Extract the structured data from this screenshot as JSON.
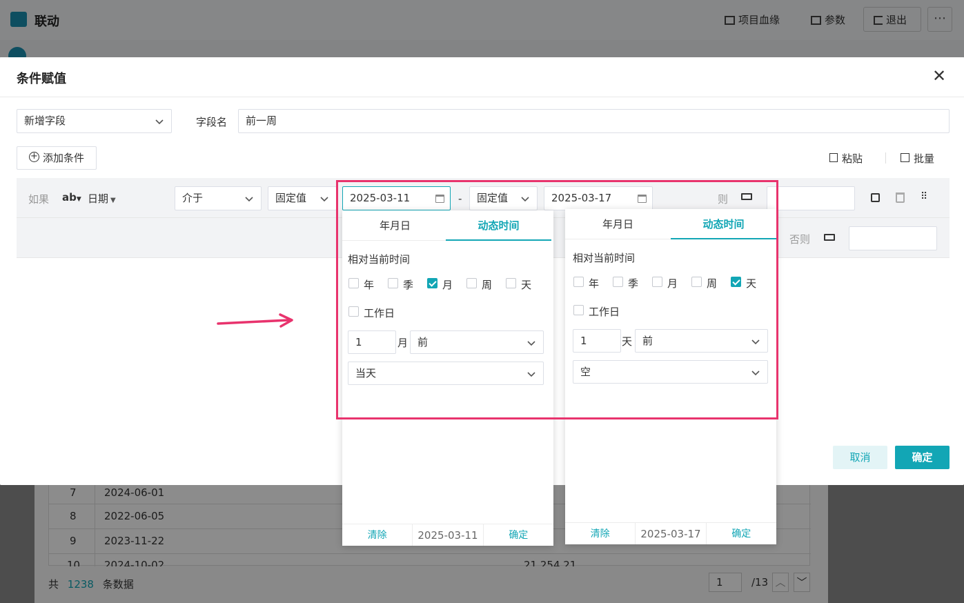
{
  "app": {
    "title": "联动",
    "lineage": "项目血缘",
    "params": "参数",
    "logout": "退出"
  },
  "bg_table": {
    "rows": [
      {
        "num": "7",
        "date": "2024-06-01"
      },
      {
        "num": "8",
        "date": "2022-06-05"
      },
      {
        "num": "9",
        "date": "2023-11-22"
      },
      {
        "num": "10",
        "date": "2024-10-02"
      }
    ],
    "partial_value": "21,254,21",
    "total_prefix": "共",
    "total_count": "1238",
    "total_suffix": "条数据",
    "page_value": "1",
    "page_total": "/13"
  },
  "dialog": {
    "title": "条件赋值",
    "field_mode": "新增字段",
    "field_name_label": "字段名",
    "field_name_value": "前一周",
    "add_condition": "添加条件",
    "paste": "粘贴",
    "batch": "批量",
    "if_label": "如果",
    "type_icon_text": "ab",
    "field_type": "日期",
    "operator": "介于",
    "value_mode_1": "固定值",
    "date_start": "2025-03-11",
    "range_sep": "-",
    "value_mode_2": "固定值",
    "date_end": "2025-03-17",
    "then_label": "则",
    "else_label": "否则",
    "cancel": "取消",
    "confirm": "确定"
  },
  "picker_left": {
    "tab_date": "年月日",
    "tab_dynamic": "动态时间",
    "relative_label": "相对当前时间",
    "units": [
      {
        "label": "年",
        "checked": false
      },
      {
        "label": "季",
        "checked": false
      },
      {
        "label": "月",
        "checked": true
      },
      {
        "label": "周",
        "checked": false
      },
      {
        "label": "天",
        "checked": false
      }
    ],
    "workday": "工作日",
    "offset_value": "1",
    "offset_unit": "月",
    "direction": "前",
    "anchor": "当天",
    "clear": "清除",
    "current": "2025-03-11",
    "ok": "确定"
  },
  "picker_right": {
    "tab_date": "年月日",
    "tab_dynamic": "动态时间",
    "relative_label": "相对当前时间",
    "units": [
      {
        "label": "年",
        "checked": false
      },
      {
        "label": "季",
        "checked": false
      },
      {
        "label": "月",
        "checked": false
      },
      {
        "label": "周",
        "checked": false
      },
      {
        "label": "天",
        "checked": true
      }
    ],
    "workday": "工作日",
    "offset_value": "1",
    "offset_unit": "天",
    "direction": "前",
    "anchor": "空",
    "clear": "清除",
    "current": "2025-03-17",
    "ok": "确定"
  },
  "colors": {
    "accent": "#12a6b5",
    "highlight": "#e8336d",
    "cancel_bg": "#e3f4f6"
  }
}
